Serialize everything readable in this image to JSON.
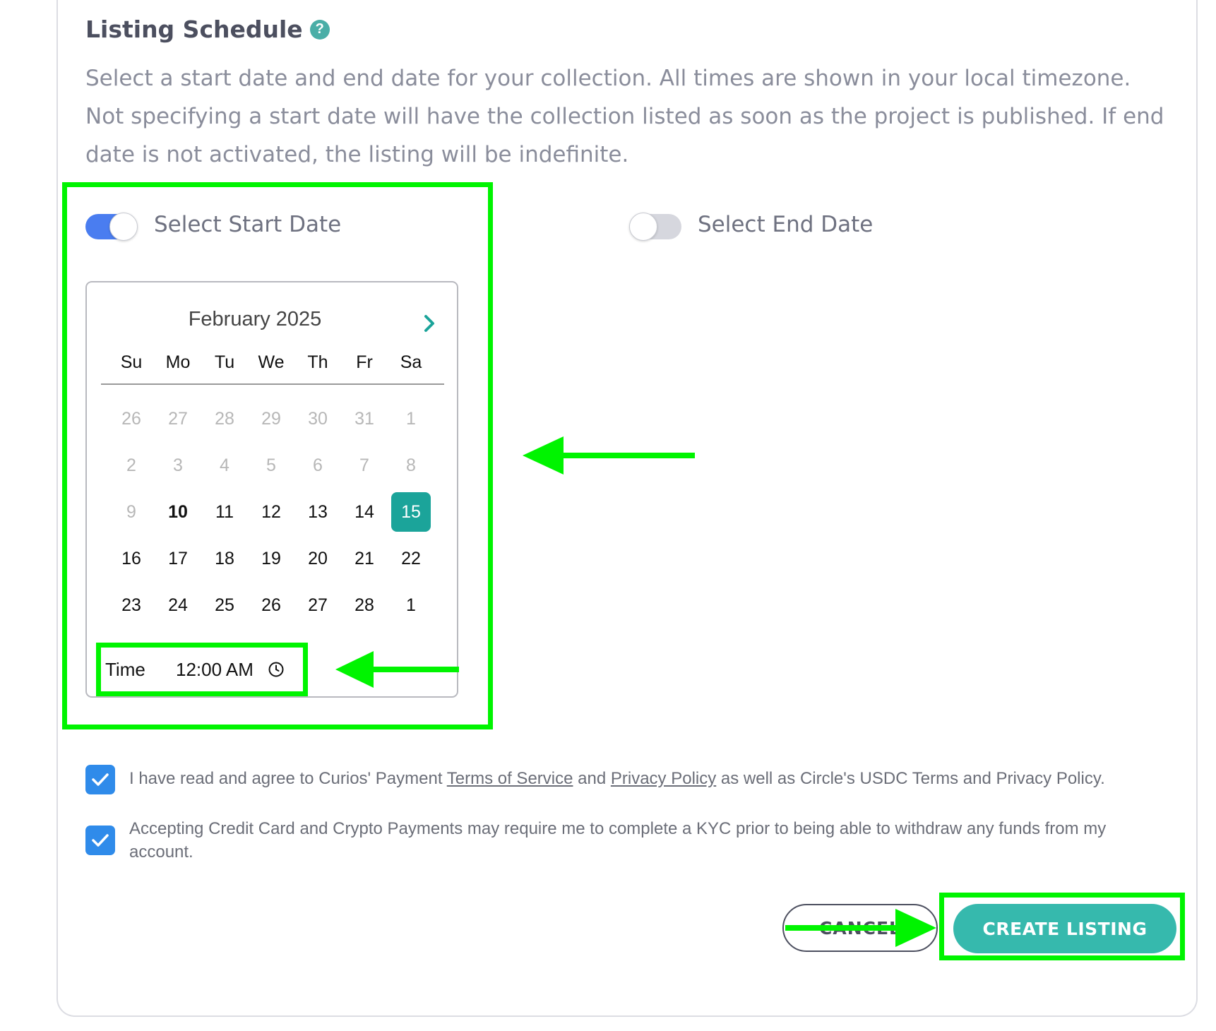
{
  "schedule": {
    "title": "Listing Schedule",
    "help_icon": "?",
    "description": "Select a start date and end date for your collection. All times are shown in your local timezone. Not specifying a start date will have the collection listed as soon as the project is published. If end date is not activated, the listing will be indefinite.",
    "start_toggle": {
      "label": "Select Start Date",
      "state": "on"
    },
    "end_toggle": {
      "label": "Select End Date",
      "state": "off"
    }
  },
  "calendar": {
    "month_label": "February 2025",
    "next_icon": "chevron-right-icon",
    "weekdays": [
      "Su",
      "Mo",
      "Tu",
      "We",
      "Th",
      "Fr",
      "Sa"
    ],
    "days": [
      {
        "label": "26",
        "state": "muted"
      },
      {
        "label": "27",
        "state": "muted"
      },
      {
        "label": "28",
        "state": "muted"
      },
      {
        "label": "29",
        "state": "muted"
      },
      {
        "label": "30",
        "state": "muted"
      },
      {
        "label": "31",
        "state": "muted"
      },
      {
        "label": "1",
        "state": "muted"
      },
      {
        "label": "2",
        "state": "muted"
      },
      {
        "label": "3",
        "state": "muted"
      },
      {
        "label": "4",
        "state": "muted"
      },
      {
        "label": "5",
        "state": "muted"
      },
      {
        "label": "6",
        "state": "muted"
      },
      {
        "label": "7",
        "state": "muted"
      },
      {
        "label": "8",
        "state": "muted"
      },
      {
        "label": "9",
        "state": "muted"
      },
      {
        "label": "10",
        "state": "today"
      },
      {
        "label": "11",
        "state": "normal"
      },
      {
        "label": "12",
        "state": "normal"
      },
      {
        "label": "13",
        "state": "normal"
      },
      {
        "label": "14",
        "state": "normal"
      },
      {
        "label": "15",
        "state": "selected"
      },
      {
        "label": "16",
        "state": "normal"
      },
      {
        "label": "17",
        "state": "normal"
      },
      {
        "label": "18",
        "state": "normal"
      },
      {
        "label": "19",
        "state": "normal"
      },
      {
        "label": "20",
        "state": "normal"
      },
      {
        "label": "21",
        "state": "normal"
      },
      {
        "label": "22",
        "state": "normal"
      },
      {
        "label": "23",
        "state": "normal"
      },
      {
        "label": "24",
        "state": "normal"
      },
      {
        "label": "25",
        "state": "normal"
      },
      {
        "label": "26",
        "state": "normal"
      },
      {
        "label": "27",
        "state": "normal"
      },
      {
        "label": "28",
        "state": "normal"
      },
      {
        "label": "1",
        "state": "normal"
      }
    ],
    "time_label": "Time",
    "time_value": "12:00 AM",
    "time_icon": "clock-icon"
  },
  "agreements": {
    "terms": {
      "before": "I have read and agree to Curios' Payment ",
      "link1": "Terms of Service",
      "middle": " and ",
      "link2": "Privacy Policy",
      "after": " as well as Circle's USDC Terms and Privacy Policy.",
      "checked": true
    },
    "kyc": {
      "text": "Accepting Credit Card and Crypto Payments may require me to complete a KYC prior to being able to withdraw any funds from my account.",
      "checked": true
    }
  },
  "actions": {
    "cancel_label": "CANCEL",
    "create_label": "CREATE LISTING"
  },
  "colors": {
    "accent_teal": "#36b9ad",
    "toggle_on": "#4a7df0",
    "checkbox": "#2f8bea",
    "annotation": "#00f400"
  }
}
